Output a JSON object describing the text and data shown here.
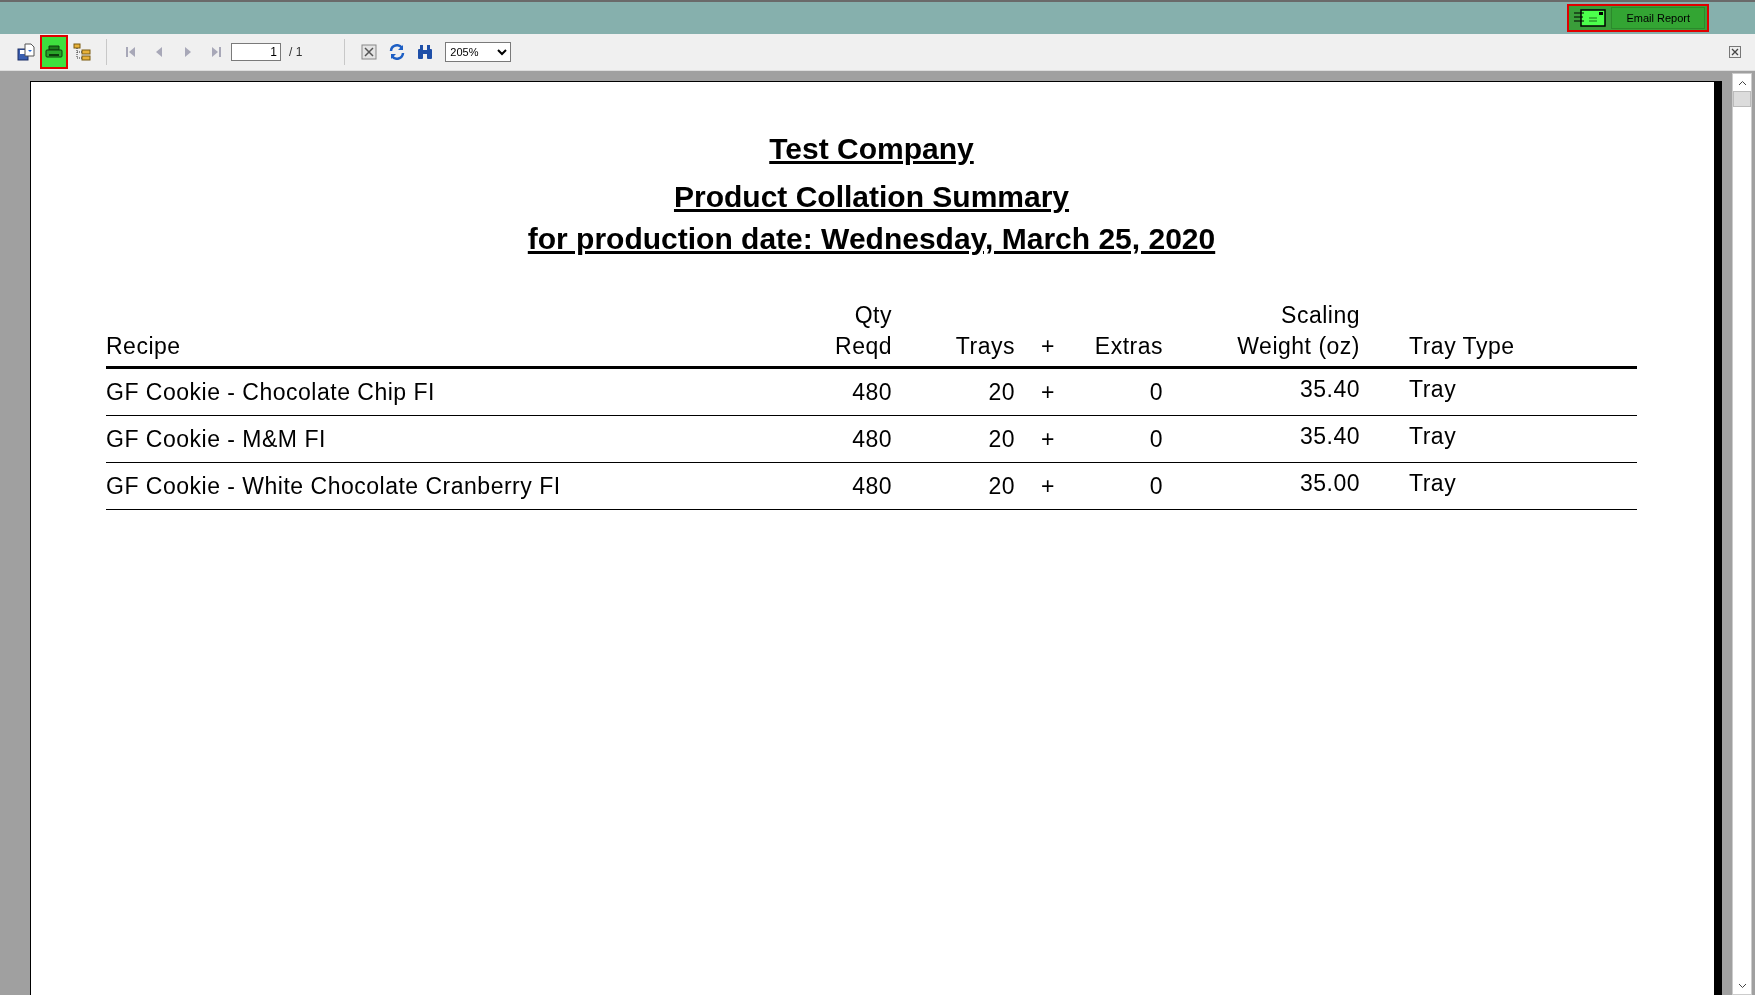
{
  "top_bar": {
    "email_button": {
      "label": "Email Report",
      "highlighted": true
    }
  },
  "toolbar": {
    "view_buttons": [
      {
        "kind": "export",
        "highlighted": false
      },
      {
        "kind": "print",
        "highlighted": true
      },
      {
        "kind": "tree",
        "highlighted": false
      }
    ],
    "nav_buttons": [
      {
        "kind": "first",
        "disabled": true
      },
      {
        "kind": "prev",
        "disabled": true
      },
      {
        "kind": "next",
        "disabled": true
      },
      {
        "kind": "last",
        "disabled": true
      }
    ],
    "page_field": {
      "value": "1"
    },
    "page_total": "/ 1",
    "tool_buttons": [
      {
        "kind": "stop"
      },
      {
        "kind": "refresh"
      },
      {
        "kind": "find"
      }
    ],
    "zoom_select": {
      "value": "205%"
    }
  },
  "report": {
    "company": "Test Company",
    "title": "Product Collation Summary",
    "subtitle": "for production date: Wednesday, March 25, 2020",
    "columns": [
      "Recipe",
      "Qty\nReqd",
      "Trays",
      "+",
      "Extras",
      "Scaling\nWeight (oz)",
      "Tray Type"
    ],
    "rows": [
      [
        "GF Cookie - Chocolate Chip FI",
        "480",
        "20",
        "+",
        "0",
        "35.40",
        "Tray"
      ],
      [
        "GF Cookie - M&M FI",
        "480",
        "20",
        "+",
        "0",
        "35.40",
        "Tray"
      ],
      [
        "GF Cookie - White Chocolate Cranberry FI",
        "480",
        "20",
        "+",
        "0",
        "35.00",
        "Tray"
      ]
    ]
  }
}
